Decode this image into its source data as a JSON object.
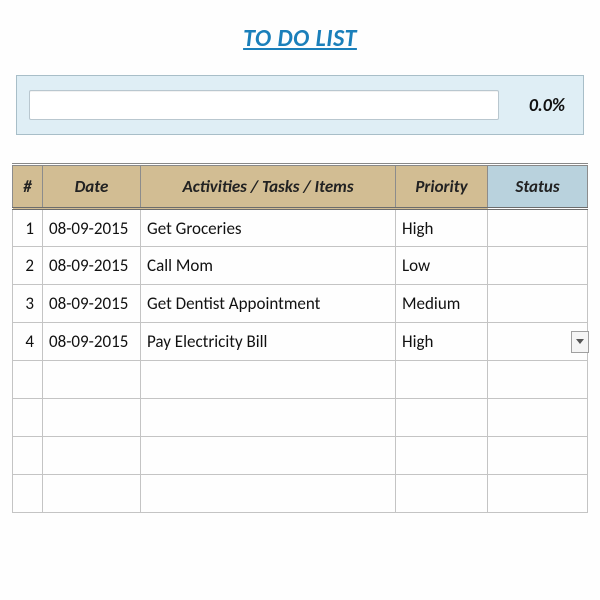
{
  "title": "TO DO LIST",
  "progress": {
    "percent_label": "0.0%"
  },
  "columns": {
    "num": "#",
    "date": "Date",
    "task": "Activities / Tasks / Items",
    "priority": "Priority",
    "status": "Status"
  },
  "rows": [
    {
      "num": "1",
      "date": "08-09-2015",
      "task": "Get Groceries",
      "priority": "High",
      "status": ""
    },
    {
      "num": "2",
      "date": "08-09-2015",
      "task": "Call Mom",
      "priority": "Low",
      "status": ""
    },
    {
      "num": "3",
      "date": "08-09-2015",
      "task": "Get Dentist Appointment",
      "priority": "Medium",
      "status": ""
    },
    {
      "num": "4",
      "date": "08-09-2015",
      "task": "Pay Electricity Bill",
      "priority": "High",
      "status": ""
    },
    {
      "num": "",
      "date": "",
      "task": "",
      "priority": "",
      "status": ""
    },
    {
      "num": "",
      "date": "",
      "task": "",
      "priority": "",
      "status": ""
    },
    {
      "num": "",
      "date": "",
      "task": "",
      "priority": "",
      "status": ""
    },
    {
      "num": "",
      "date": "",
      "task": "",
      "priority": "",
      "status": ""
    }
  ],
  "active_dropdown_row": 3
}
